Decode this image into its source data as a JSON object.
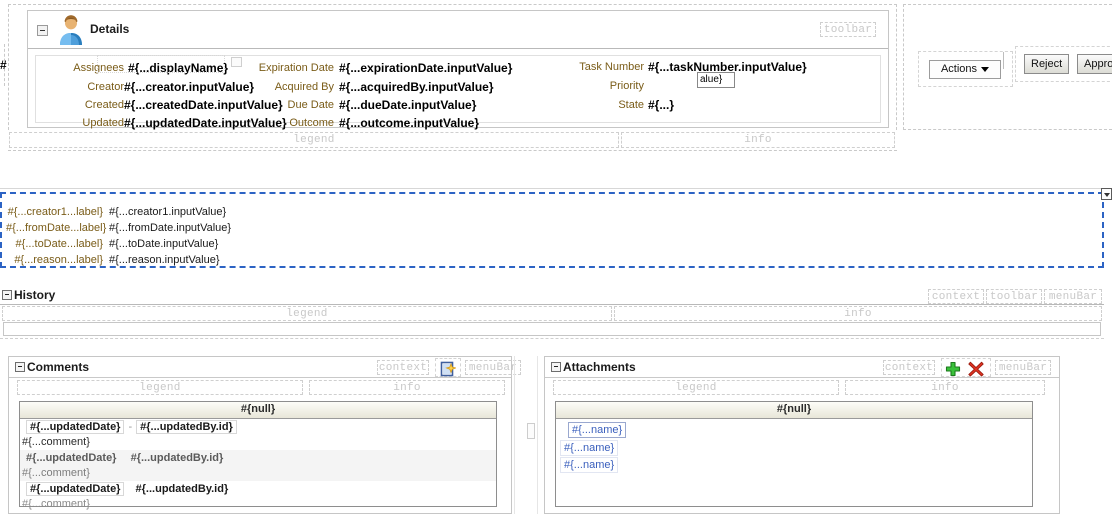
{
  "details": {
    "title": "Details",
    "icon": "person-avatar-icon",
    "toolbar_facet": "toolbar",
    "legend_facet": "legend",
    "info_facet": "info",
    "fields_left": [
      {
        "label": "Assignees",
        "value": "#{...displayName}"
      },
      {
        "label": "Creator",
        "value": "#{...creator.inputValue}"
      },
      {
        "label": "Created",
        "value": "#{...createdDate.inputValue}"
      },
      {
        "label": "Updated",
        "value": "#{...updatedDate.inputValue}"
      }
    ],
    "fields_mid": [
      {
        "label": "Expiration Date",
        "value": "#{...expirationDate.inputValue}"
      },
      {
        "label": "Acquired By",
        "value": "#{...acquiredBy.inputValue}"
      },
      {
        "label": "Due Date",
        "value": "#{...dueDate.inputValue}"
      },
      {
        "label": "Outcome",
        "value": "#{...outcome.inputValue}"
      }
    ],
    "fields_right": [
      {
        "label": "Task Number",
        "value": "#{...taskNumber.inputValue}"
      },
      {
        "label": "Priority",
        "value": "alue}"
      },
      {
        "label": "State",
        "value": "#{...}"
      }
    ]
  },
  "clipped_left_text": "#",
  "actions": {
    "actions_label": "Actions",
    "reject_label": "Reject",
    "approve_label": "Approve"
  },
  "middle_form": {
    "rows": [
      {
        "label": "#{...creator1...label}",
        "value": "#{...creator1.inputValue}"
      },
      {
        "label": "#{...fromDate...label}",
        "value": "#{...fromDate.inputValue}"
      },
      {
        "label": "#{...toDate...label}",
        "value": "#{...toDate.inputValue}"
      },
      {
        "label": "#{...reason...label}",
        "value": "#{...reason.inputValue}"
      }
    ],
    "selection_color": "#2c63c4"
  },
  "history": {
    "title": "History",
    "context_facet": "context",
    "toolbar_facet": "toolbar",
    "menubar_facet": "menuBar",
    "legend_facet": "legend",
    "info_facet": "info"
  },
  "comments": {
    "title": "Comments",
    "context_facet": "context",
    "menubar_facet": "menuBar",
    "add_icon": "new-comment-icon",
    "legend_facet": "legend",
    "info_facet": "info",
    "column_header": "#{null}",
    "rows": [
      {
        "date": "#{...updatedDate}",
        "separator": "-",
        "author": "#{...updatedBy.id}",
        "body": "#{...comment}"
      },
      {
        "date": "#{...updatedDate}",
        "separator": "",
        "author": "#{...updatedBy.id}",
        "body": "#{...comment}"
      },
      {
        "date": "#{...updatedDate}",
        "separator": "",
        "author": "#{...updatedBy.id}",
        "body": "#{...comment}"
      }
    ]
  },
  "attachments": {
    "title": "Attachments",
    "context_facet": "context",
    "menubar_facet": "menuBar",
    "add_icon": "green-plus-icon",
    "delete_icon": "red-x-icon",
    "legend_facet": "legend",
    "info_facet": "info",
    "column_header": "#{null}",
    "rows": [
      {
        "name": "#{...name}"
      },
      {
        "name": "#{...name}"
      },
      {
        "name": "#{...name}"
      }
    ]
  }
}
